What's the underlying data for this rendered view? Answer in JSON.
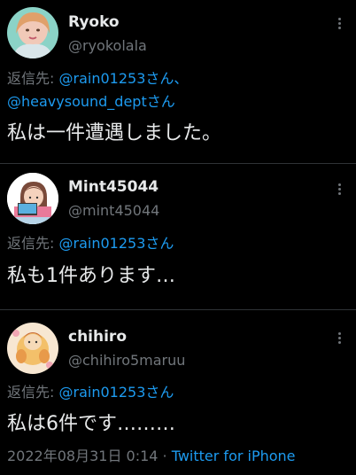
{
  "tweets": [
    {
      "name": "Ryoko",
      "handle": "@ryokolala",
      "replying_prefix": "返信先:",
      "mentions": [
        "@rain01253さん、",
        "@heavysound_deptさん"
      ],
      "text": "私は一件遭遇しました。",
      "avatar": "avatar-ryoko"
    },
    {
      "name": "Mint45044",
      "handle": "@mint45044",
      "replying_prefix": "返信先:",
      "mentions": [
        "@rain01253さん"
      ],
      "text": "私も1件あります…",
      "avatar": "avatar-mint"
    },
    {
      "name": "chihiro",
      "handle": "@chihiro5maruu",
      "replying_prefix": "返信先:",
      "mentions": [
        "@rain01253さん"
      ],
      "text": "私は6件です………",
      "timestamp": "2022年08月31日 0:14 · ",
      "source": "Twitter for iPhone",
      "avatar": "avatar-chihiro"
    }
  ],
  "icons": {
    "more": "more-vertical-icon"
  },
  "colors": {
    "background": "#000000",
    "text": "#e7e9ea",
    "secondary": "#71767b",
    "link": "#1d9bf0",
    "divider": "#2f3336"
  }
}
